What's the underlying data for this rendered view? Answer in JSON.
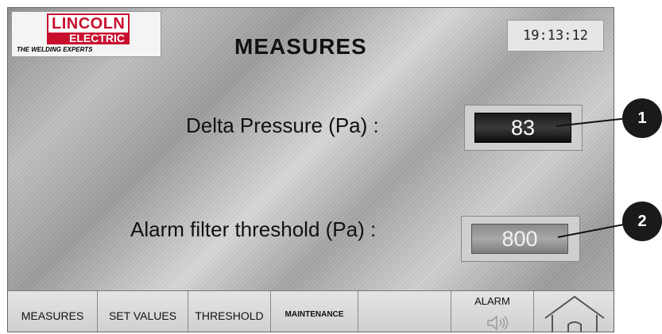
{
  "logo": {
    "line1": "LINCOLN",
    "line2": "ELECTRIC",
    "tagline": "THE WELDING EXPERTS"
  },
  "header": {
    "title": "MEASURES",
    "clock": "19:13:12"
  },
  "measures": [
    {
      "label": "Delta Pressure  (Pa) :",
      "value": "83"
    },
    {
      "label": "Alarm filter threshold (Pa) :",
      "value": "800"
    }
  ],
  "callouts": [
    "1",
    "2"
  ],
  "bottom_nav": {
    "measures": "MEASURES",
    "set_values": "SET VALUES",
    "threshold": "THRESHOLD",
    "maintenance": "MAINTENANCE",
    "alarm": "ALARM"
  },
  "icons": {
    "speaker": "speaker-icon",
    "home": "home-icon"
  },
  "colors": {
    "brand_red": "#c8102e",
    "value_dark": "#1b1b1b",
    "callout": "#1a1a1a"
  }
}
